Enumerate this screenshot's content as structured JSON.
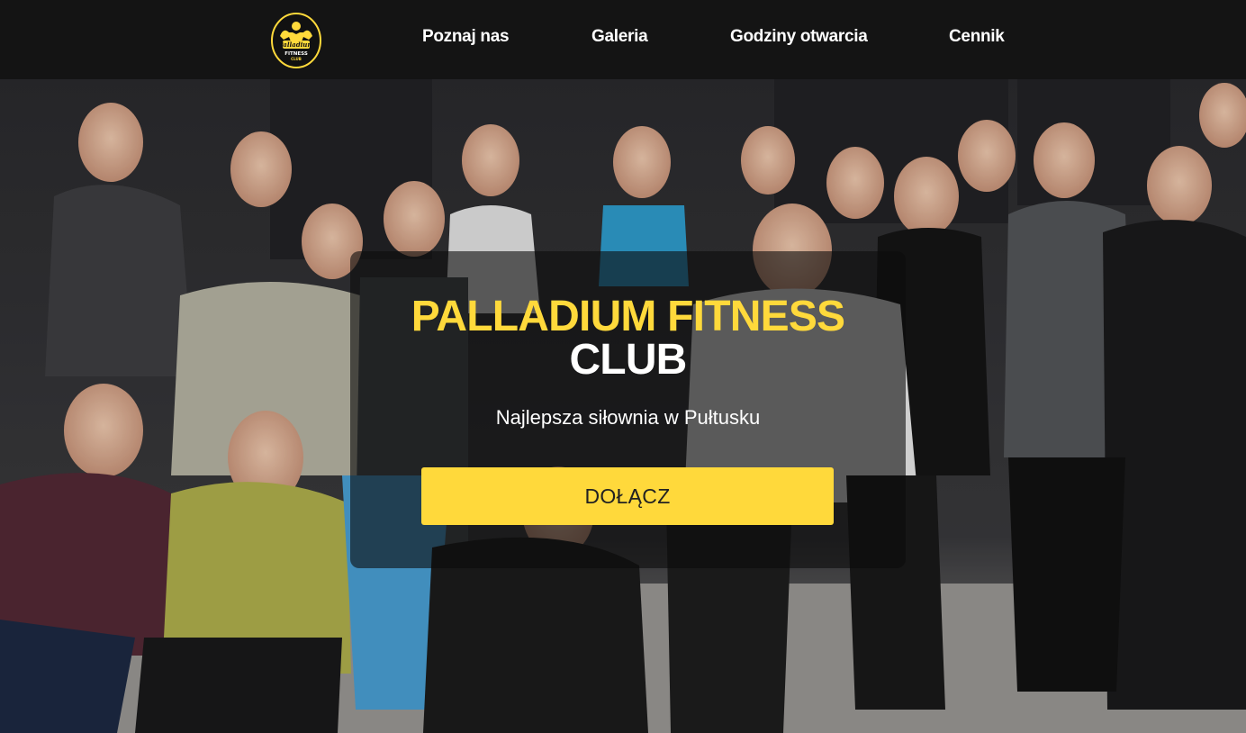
{
  "header": {
    "logo_name": "palladium-fitness-logo",
    "logo_text": "Palladium FITNESS CLUB",
    "nav": [
      {
        "label": "Poznaj nas"
      },
      {
        "label": "Galeria"
      },
      {
        "label": "Godziny otwarcia"
      },
      {
        "label": "Cennik"
      }
    ]
  },
  "hero": {
    "title_line1": "PALLADIUM FITNESS",
    "title_line2": "CLUB",
    "tagline": "Najlepsza siłownia w Pułtusku",
    "cta_label": "DOŁĄCZ"
  },
  "colors": {
    "accent": "#ffd93b",
    "navbar_bg": "#141414",
    "panel_bg": "rgba(12,12,12,0.60)",
    "text_light": "#ffffff"
  }
}
